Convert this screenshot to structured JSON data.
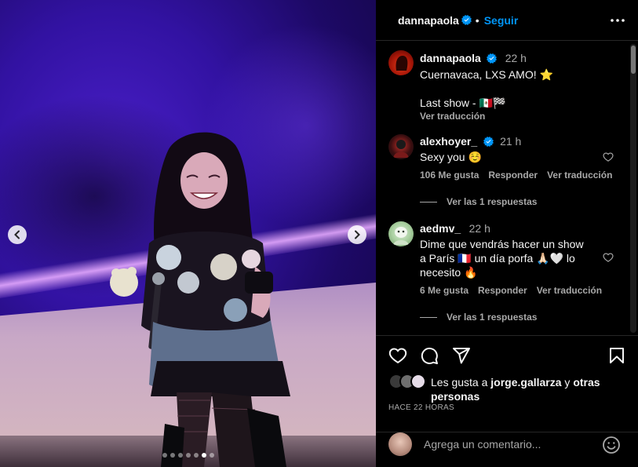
{
  "post": {
    "username": "dannapaola",
    "follow_label": "Seguir",
    "separator": "•",
    "carousel": {
      "total_slides": 7,
      "active_slide": 6
    }
  },
  "caption": {
    "username": "dannapaola",
    "time": "22 h",
    "line1": "Cuernavaca, LXS AMO! ⭐️",
    "line2": "Last show - 🇲🇽🏁",
    "translate": "Ver traducción"
  },
  "comments": [
    {
      "username": "alexhoyer_",
      "verified": true,
      "time": "21 h",
      "text": "Sexy you ☺️",
      "likes": "106 Me gusta",
      "reply": "Responder",
      "translate": "Ver traducción",
      "replies": "Ver las 1 respuestas"
    },
    {
      "username": "aedmv_",
      "verified": false,
      "time": "22 h",
      "text_line1": "Dime que vendrás hacer un show",
      "text_line2": "a París 🇫🇷 un día porfa 🙏🏻🤍 lo",
      "text_line3": "necesito 🔥",
      "likes": "6 Me gusta",
      "reply": "Responder",
      "translate": "Ver traducción",
      "replies": "Ver las 1 respuestas"
    }
  ],
  "likes": {
    "prefix": "Les gusta a ",
    "user": "jorge.gallarza",
    "connector": " y ",
    "others_line1": "otras",
    "others_line2": "personas"
  },
  "timestamp": "HACE 22 HORAS",
  "add_comment": {
    "placeholder": "Agrega un comentario..."
  },
  "colors": {
    "accent": "#0095f6",
    "verified": "#0095f6",
    "muted": "#a8a8a8",
    "divider": "#262626"
  },
  "icons": [
    "verified-badge-icon",
    "more-options-icon",
    "heart-icon",
    "comment-icon",
    "share-icon",
    "bookmark-icon",
    "emoji-icon",
    "chevron-left-icon",
    "chevron-right-icon"
  ]
}
